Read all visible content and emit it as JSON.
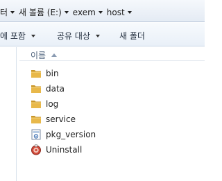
{
  "breadcrumb": {
    "items": [
      "터",
      "새 볼륨 (E:)",
      "exem",
      "host"
    ]
  },
  "toolbar": {
    "include_label": "에 포함",
    "share_label": "공유 대상",
    "new_folder_label": "새 폴더"
  },
  "list_header": {
    "name_label": "이름"
  },
  "files": [
    {
      "name": "bin",
      "icon": "folder-icon"
    },
    {
      "name": "data",
      "icon": "folder-icon"
    },
    {
      "name": "log",
      "icon": "folder-icon"
    },
    {
      "name": "service",
      "icon": "folder-icon"
    },
    {
      "name": "pkg_version",
      "icon": "file-icon"
    },
    {
      "name": "Uninstall",
      "icon": "uninstall-icon"
    }
  ],
  "colors": {
    "folder": "#e8b84a",
    "folder_dark": "#c8962a",
    "accent": "#4c607a"
  }
}
